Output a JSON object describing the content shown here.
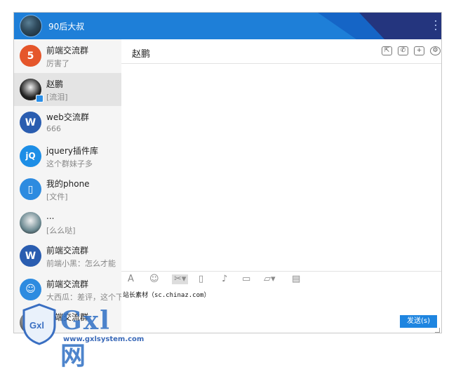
{
  "header": {
    "user_name": "90后大叔"
  },
  "conversations": [
    {
      "name": "前端交流群",
      "last_message": "厉害了",
      "avatar": "html5-icon",
      "color": "#e5562b",
      "glyph": "5"
    },
    {
      "name": "赵鹏",
      "last_message": "[流泪]",
      "avatar": "avatar-photo",
      "color": "#222222",
      "glyph": "",
      "active": true
    },
    {
      "name": "web交流群",
      "last_message": "666",
      "avatar": "web-logo",
      "color": "#2a5db0",
      "glyph": "W"
    },
    {
      "name": "jquery插件库",
      "last_message": "这个群妹子多",
      "avatar": "jq-logo",
      "color": "#1d8ee6",
      "glyph": "jQ"
    },
    {
      "name": "我的phone",
      "last_message": "[文件]",
      "avatar": "phone-icon",
      "color": "#2d8be0",
      "glyph": "▯"
    },
    {
      "name": "...",
      "last_message": "[么么哒]",
      "avatar": "avatar-photo",
      "color": "#6a8890",
      "glyph": ""
    },
    {
      "name": "前端交流群",
      "last_message": "前端小黑：怎么才能",
      "avatar": "web-logo",
      "color": "#2a5db0",
      "glyph": "W"
    },
    {
      "name": "前端交流群",
      "last_message": "大西瓜：差评，这个下",
      "avatar": "user-icon",
      "color": "#2d8be0",
      "glyph": "☺"
    },
    {
      "name": "前端交流群",
      "last_message": "",
      "avatar": "avatar-photo",
      "color": "#777777",
      "glyph": ""
    }
  ],
  "chat": {
    "title": "赵鹏"
  },
  "input": {
    "text": "站长素材（sc.chinaz.com）"
  },
  "send_button": {
    "label": "发送(s)"
  },
  "watermark": {
    "brand": "Gxl 网",
    "url": "www.gxlsystem.com"
  }
}
